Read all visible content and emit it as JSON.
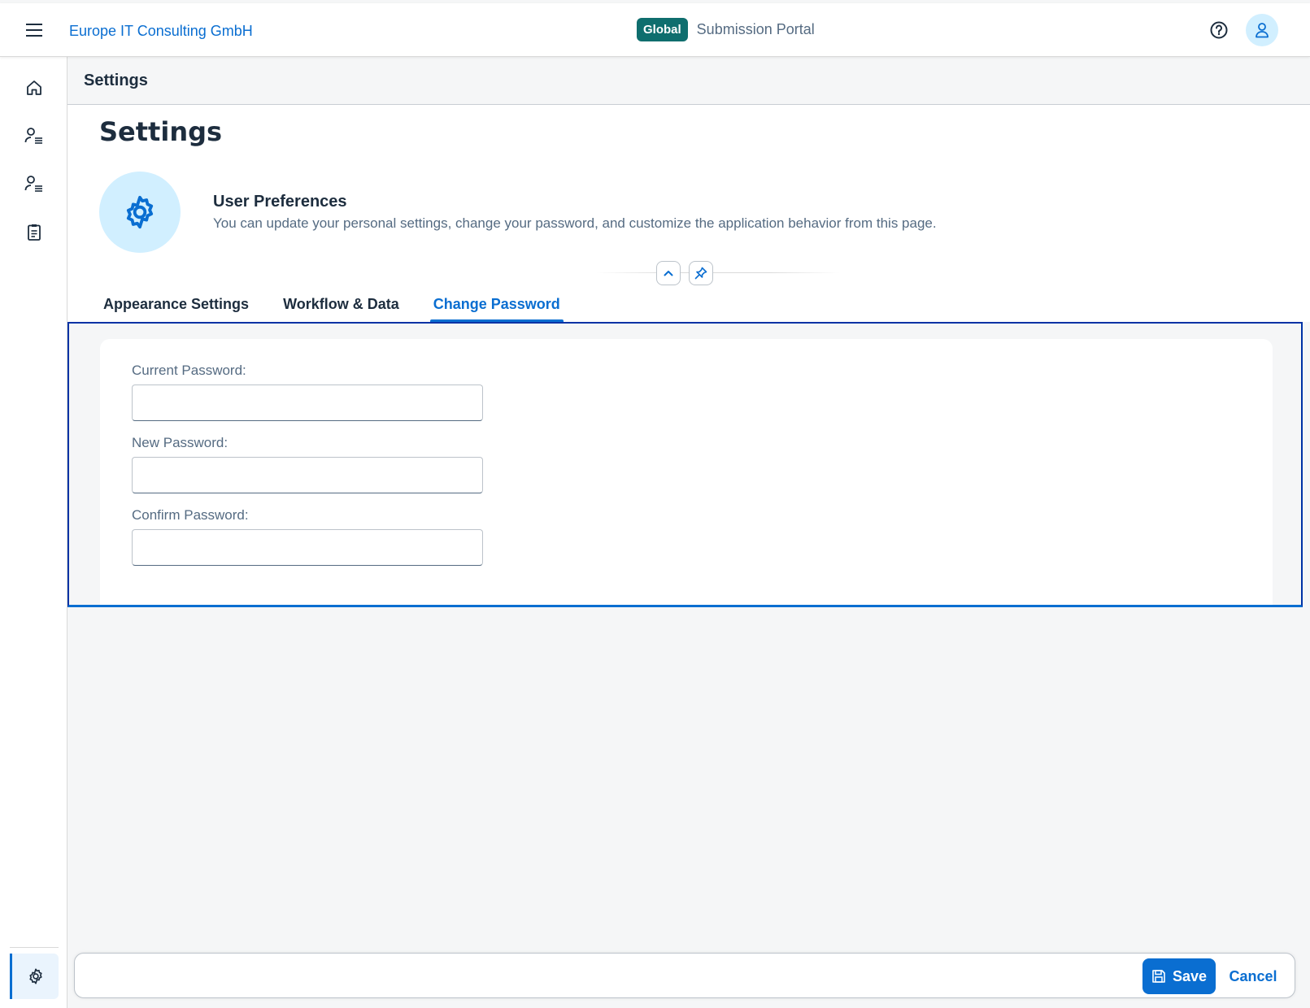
{
  "shell": {
    "company": "Europe IT Consulting GmbH",
    "environment_badge": "Global",
    "portal_name": "Submission Portal",
    "icons": [
      "hamburger-menu-icon",
      "help-icon",
      "user-avatar-icon"
    ]
  },
  "sidenav": {
    "items": [
      {
        "name": "home",
        "icon": "home-icon"
      },
      {
        "name": "user-list-1",
        "icon": "user-list-icon"
      },
      {
        "name": "user-list-2",
        "icon": "user-list-icon"
      },
      {
        "name": "checklist",
        "icon": "clipboard-icon"
      }
    ],
    "bottom_item": {
      "name": "settings",
      "icon": "gear-icon",
      "active": true
    }
  },
  "titlebar": {
    "title": "Settings"
  },
  "header": {
    "title": "Settings",
    "subtitle": "User Preferences",
    "description": "You can update your personal settings, change your password, and customize the application behavior from this page.",
    "avatar_icon": "gear-icon"
  },
  "tabs": [
    {
      "label": "Appearance Settings",
      "selected": false
    },
    {
      "label": "Workflow & Data",
      "selected": false
    },
    {
      "label": "Change Password",
      "selected": true
    }
  ],
  "form": {
    "fields": [
      {
        "label": "Current Password:",
        "value": ""
      },
      {
        "label": "New Password:",
        "value": ""
      },
      {
        "label": "Confirm Password:",
        "value": ""
      }
    ]
  },
  "footer": {
    "save_label": "Save",
    "cancel_label": "Cancel"
  },
  "colors": {
    "accent": "#0a6ed1",
    "badge": "#0f6e6e",
    "avatar_bg": "#d1efff",
    "section_border": "#0032a5"
  }
}
